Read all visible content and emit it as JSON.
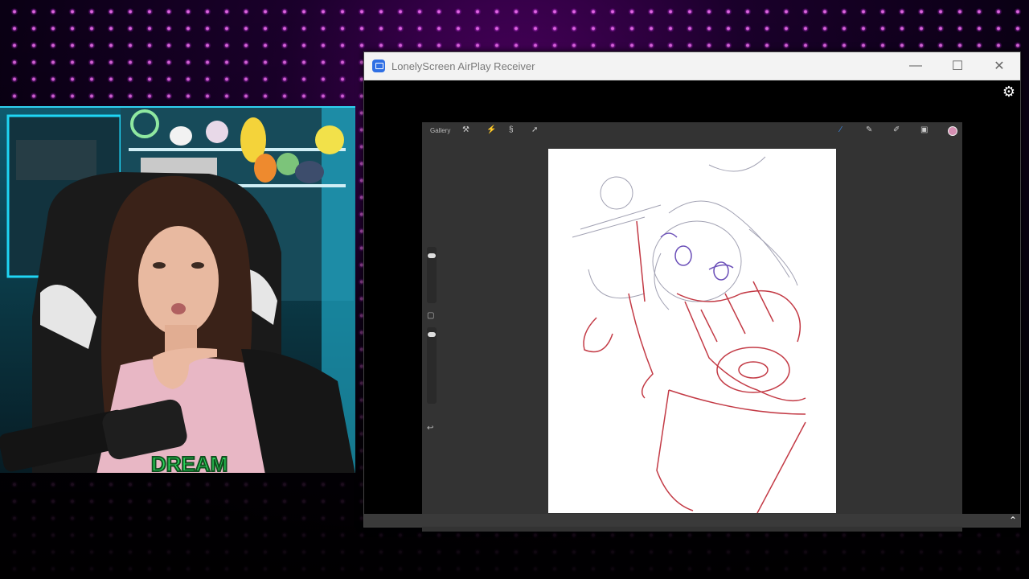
{
  "window": {
    "title": "LonelyScreen AirPlay Receiver",
    "minimize": "—",
    "maximize": "☐",
    "close": "✕"
  },
  "procreate": {
    "gallery_label": "Gallery",
    "color": "#d58fb2"
  },
  "webcam": {
    "shirt_text": "DREAM"
  },
  "icons": {
    "gear": "⚙",
    "chevron_up": "⌃"
  }
}
